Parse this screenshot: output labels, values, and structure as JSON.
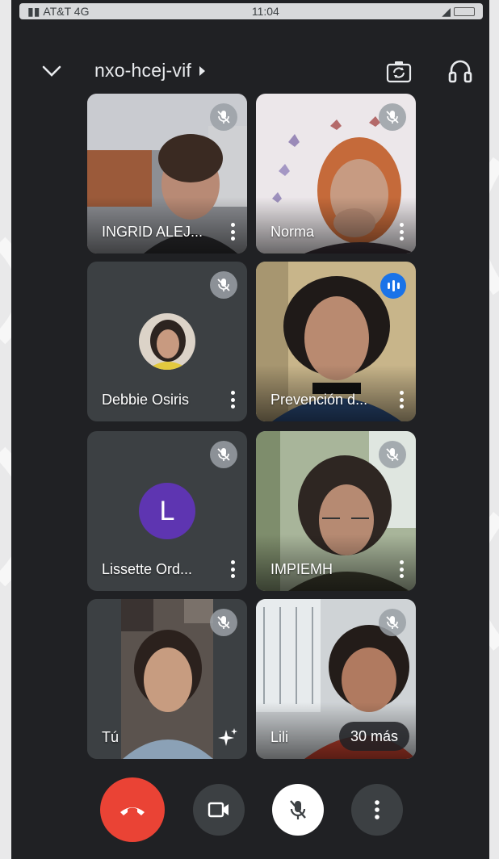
{
  "status_bar": {
    "carrier": "AT&T 4G",
    "time": "11:04"
  },
  "header": {
    "meeting_code": "nxo-hcej-vif"
  },
  "participants": [
    {
      "name": "INGRID ALEJ...",
      "muted": true
    },
    {
      "name": "Norma",
      "muted": true
    },
    {
      "name": "Debbie Osiris",
      "muted": true
    },
    {
      "name": "Prevención d...",
      "muted": false,
      "speaking": true
    },
    {
      "name": "Lissette Ord...",
      "muted": true,
      "avatar_letter": "L",
      "avatar_color": "#5e35b1"
    },
    {
      "name": "IMPIEMH",
      "muted": true
    },
    {
      "name": "Tú",
      "muted": true
    },
    {
      "name": "Lili",
      "muted": true,
      "more_label": "30 más"
    }
  ],
  "colors": {
    "background": "#202124",
    "tile": "#3c4043",
    "end_call": "#ea4335",
    "speaking_badge": "#1a73e8"
  },
  "controls": {
    "end_call_icon": "phone-hangup-icon",
    "camera_icon": "video-camera-icon",
    "mic_icon": "mic-off-icon",
    "more_icon": "more-vertical-icon"
  }
}
